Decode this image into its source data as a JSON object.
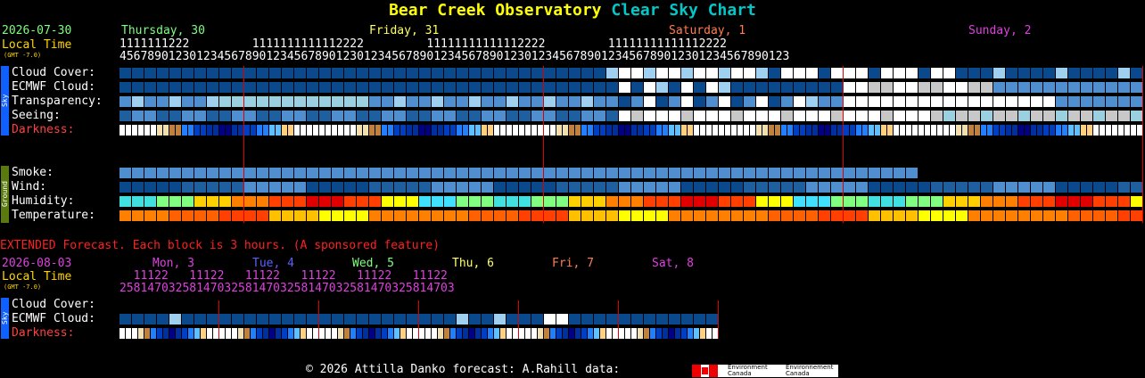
{
  "title": {
    "part1": "Bear Creek Observatory",
    "part2": "Clear Sky Chart"
  },
  "header": {
    "date": "2026-07-30",
    "local_time": "Local Time",
    "gmt": "(GMT -7.0)",
    "days": [
      {
        "label": "Thursday, 30",
        "color": "#7fff7f"
      },
      {
        "label": "Friday, 31",
        "color": "#ffff66"
      },
      {
        "label": "Saturday, 1",
        "color": "#ff7f50"
      },
      {
        "label": "Sunday, 2",
        "color": "#e040e0"
      }
    ],
    "hours_tens": "1111111222         1111111111112222         11111111111112222         11111111111112222",
    "hours_ones": "456789012301234567890123456789012301234567890123456789012301234567890123456789012301234567890123"
  },
  "sky_rows": [
    "Cloud Cover:",
    "ECMWF Cloud:",
    "Transparency:",
    "Seeing:",
    "Darkness:"
  ],
  "ground_rows": [
    "Smoke:",
    "Wind:",
    "Humidity:",
    "Temperature:"
  ],
  "side_labels": {
    "sky": "Sky",
    "ground": "Ground"
  },
  "extended": {
    "note": "EXTENDED Forecast. Each block is 3 hours. (A sponsored feature)",
    "date": "2026-08-03",
    "local_time": "Local Time",
    "gmt": "(GMT -7.0)",
    "days": [
      {
        "label": "Mon, 3",
        "color": "#e040e0"
      },
      {
        "label": "Tue, 4",
        "color": "#6060ff"
      },
      {
        "label": "Wed, 5",
        "color": "#7fff7f"
      },
      {
        "label": "Thu, 6",
        "color": "#ffff66"
      },
      {
        "label": "Fri, 7",
        "color": "#ff7f50"
      },
      {
        "label": "Sat, 8",
        "color": "#e040e0"
      }
    ],
    "hours_tens": "  11122   11122   11122   11122   11122   11122",
    "hours_ones": "258147032581470325814703258147032581470325814703",
    "rows": [
      "Cloud Cover:",
      "ECMWF Cloud:",
      "Darkness:"
    ]
  },
  "footer": {
    "text": "© 2026 Attilla Danko  forecast: A.Rahill  data:",
    "logo_text_en": "Environment Canada",
    "logo_text_fr": "Environnement Canada"
  },
  "colors": {
    "label_darkness": "#ff4040",
    "separator": "#dd0000",
    "extended_note": "#ff2020"
  }
}
